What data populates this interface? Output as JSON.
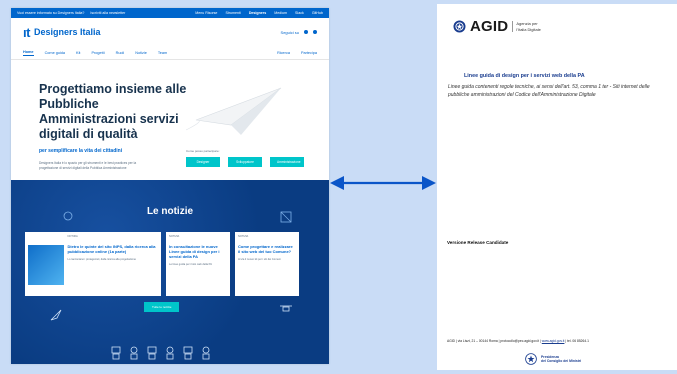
{
  "site": {
    "topbar": {
      "left": "Vuoi essere informato su Designers Italia?",
      "left2": "Iscriviti alla newsletter",
      "right": [
        "Menu Risorse",
        "Strumenti",
        "Designers",
        "Medium",
        "Slack",
        "GitHub"
      ],
      "active_index": 2
    },
    "header": {
      "logo_mark": "ıt",
      "logo_text": "Designers Italia",
      "follow": "Seguici su"
    },
    "nav": {
      "items": [
        "Home",
        "Come guida",
        "Kit",
        "Progetti",
        "Ruoli",
        "Notizie",
        "Team"
      ],
      "right": [
        "Ricerca",
        "Partecipa"
      ]
    },
    "hero": {
      "title": "Progettiamo insieme alle Pubbliche Amministrazioni servizi digitali di qualità",
      "subtitle": "per semplificare la vita dei cittadini",
      "text": "Designers Italia è lo spazio per gli strumenti e le best practices per la progettazione di servizi digitali della Pubblica Amministrazione",
      "ctas_label": "Come posso partecipare:",
      "ctas": [
        "Designer",
        "Sviluppatore",
        "Amministrazione"
      ]
    },
    "news": {
      "heading": "Le notizie",
      "cards": [
        {
          "meta": "NOTIZIA",
          "title": "Dietro le quinte del sito INPS, dalla ricerca alla pubblicazione online (1a parte)",
          "desc": "Lo raccontano i protagonisti, dalla ricerca alla progettazione"
        },
        {
          "meta": "NOTIZIA",
          "title": "In consultazione le nuove Linee guida di design per i servizi della PA",
          "desc": "Le linee guida per il sito web della PA"
        },
        {
          "meta": "NOTIZIA",
          "title": "Come progettare e realizzare il sito web del tuo Comune?",
          "desc": "Al via il nuovo kit per i siti dei Comuni"
        }
      ],
      "all_button": "Tutte le notizie"
    }
  },
  "doc": {
    "agid_word": "AGID",
    "agid_sub": [
      "Agenzia per",
      "l'Italia Digitale"
    ],
    "title": "Linee guida di design per i servizi web della PA",
    "description": "Linee guida contenenti regole tecniche, ai sensi dell'art. 53, comma 1 ter - Siti internet delle pubbliche amministrazioni del Codice dell'Amministrazione Digitale",
    "version": "Versione Release Candidate",
    "footer": "AGID | via Liszt, 21 – 00144 Roma | protocollo@pec.agid.gov.it |",
    "footer_link": "www.agid.gov.it",
    "footer_tail": "| tel. 06 85264.1",
    "presidenza": [
      "Presidenza",
      "del Consiglio dei Ministri"
    ]
  }
}
